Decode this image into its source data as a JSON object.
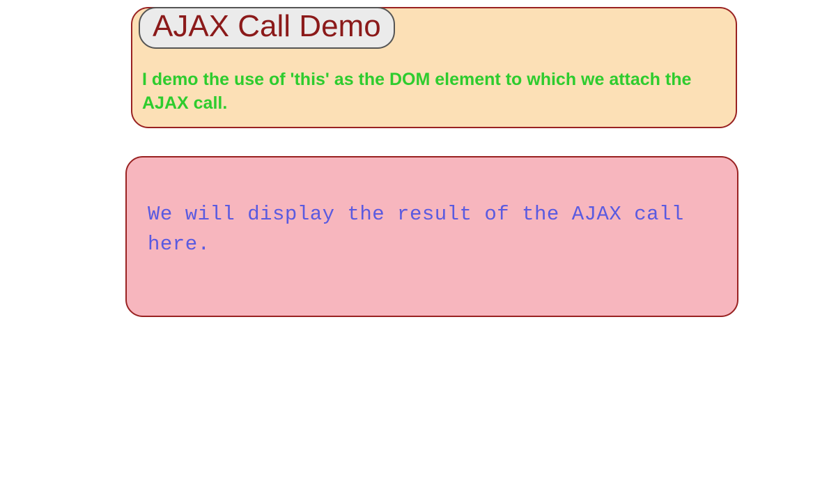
{
  "header": {
    "title": "AJAX Call Demo",
    "description": "I demo the use of 'this' as the DOM element to which we attach the AJAX call."
  },
  "result": {
    "text": "We will display the result of the AJAX call here."
  }
}
